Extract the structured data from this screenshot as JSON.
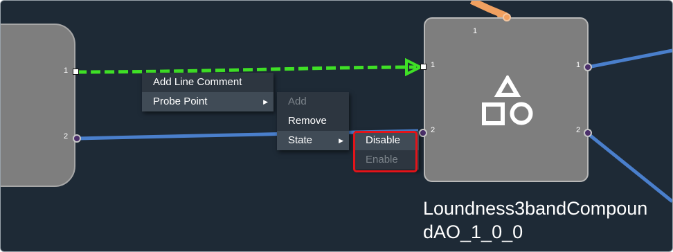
{
  "left_block": {
    "ports": [
      "1",
      "2"
    ]
  },
  "main_block": {
    "top_port": "1",
    "input_ports": [
      "1",
      "2"
    ],
    "output_ports": [
      "1",
      "2"
    ],
    "icon": "shapes-icon",
    "name": "Loundness3bandCompoundAO_1_0_0"
  },
  "colors": {
    "canvas": "#1e2a36",
    "block": "#7e7e7e",
    "selected_wire": "#3fe026",
    "wire": "#4a7fcc",
    "top_wire": "#f0a060",
    "highlight": "#e3141a"
  },
  "context_menu": {
    "items": [
      {
        "label": "Add Line Comment"
      },
      {
        "label": "Probe Point",
        "has_submenu": true
      }
    ]
  },
  "probe_submenu": {
    "items": [
      {
        "label": "Add",
        "disabled": true
      },
      {
        "label": "Remove"
      },
      {
        "label": "State",
        "has_submenu": true
      }
    ]
  },
  "state_submenu": {
    "items": [
      {
        "label": "Disable"
      },
      {
        "label": "Enable",
        "disabled": true
      }
    ]
  }
}
